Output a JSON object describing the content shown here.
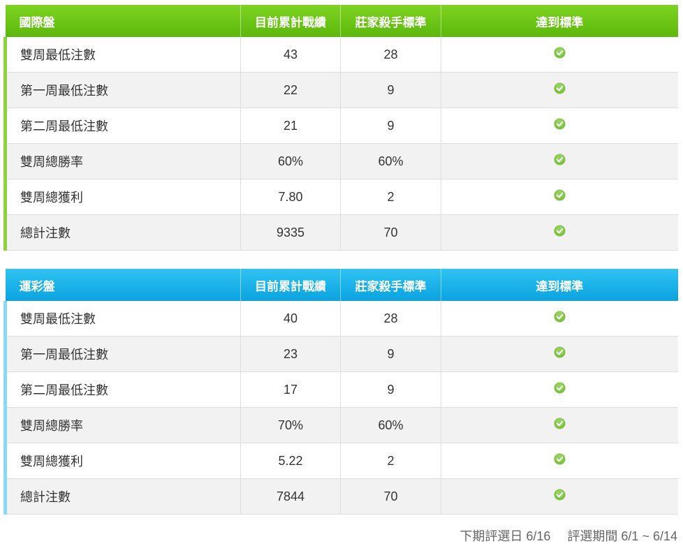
{
  "tables": [
    {
      "id": "intl",
      "headers": [
        "國際盤",
        "目前累計戰績",
        "莊家殺手標準",
        "達到標準"
      ],
      "accent": "#6cc417",
      "rows": [
        {
          "label": "雙周最低注數",
          "current": "43",
          "standard": "28",
          "status_icon": "check-circle-icon"
        },
        {
          "label": "第一周最低注數",
          "current": "22",
          "standard": "9",
          "status_icon": "check-circle-icon"
        },
        {
          "label": "第二周最低注數",
          "current": "21",
          "standard": "9",
          "status_icon": "check-circle-icon"
        },
        {
          "label": "雙周總勝率",
          "current": "60%",
          "standard": "60%",
          "status_icon": "check-circle-icon"
        },
        {
          "label": "雙周總獲利",
          "current": "7.80",
          "standard": "2",
          "status_icon": "check-circle-icon"
        },
        {
          "label": "總計注數",
          "current": "9335",
          "standard": "70",
          "status_icon": "check-circle-icon"
        }
      ]
    },
    {
      "id": "sport",
      "headers": [
        "運彩盤",
        "目前累計戰績",
        "莊家殺手標準",
        "達到標準"
      ],
      "accent": "#1ab4ea",
      "rows": [
        {
          "label": "雙周最低注數",
          "current": "40",
          "standard": "28",
          "status_icon": "check-circle-icon"
        },
        {
          "label": "第一周最低注數",
          "current": "23",
          "standard": "9",
          "status_icon": "check-circle-icon"
        },
        {
          "label": "第二周最低注數",
          "current": "17",
          "standard": "9",
          "status_icon": "check-circle-icon"
        },
        {
          "label": "雙周總勝率",
          "current": "70%",
          "standard": "60%",
          "status_icon": "check-circle-icon"
        },
        {
          "label": "雙周總獲利",
          "current": "5.22",
          "standard": "2",
          "status_icon": "check-circle-icon"
        },
        {
          "label": "總計注數",
          "current": "7844",
          "standard": "70",
          "status_icon": "check-circle-icon"
        }
      ]
    }
  ],
  "footer": {
    "next_review": "下期評選日 6/16",
    "review_period": "評選期間 6/1 ~ 6/14"
  },
  "colors": {
    "check": "#7cc242"
  }
}
